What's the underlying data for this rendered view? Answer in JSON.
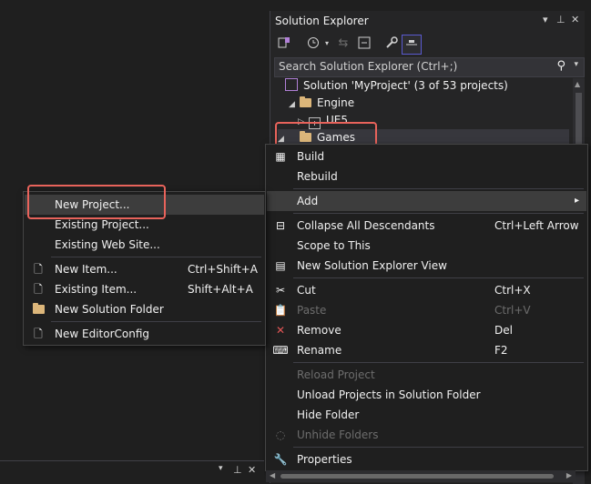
{
  "solution_explorer": {
    "title": "Solution Explorer",
    "title_icons": {
      "dropdown": "▾",
      "pin": "⊥",
      "close": "✕"
    },
    "search_placeholder": "Search Solution Explorer (Ctrl+;)",
    "tree": [
      {
        "label": "Solution 'MyProject' (3 of 53 projects)",
        "icon": "solution-icon"
      },
      {
        "label": "Engine",
        "icon": "folder-icon"
      },
      {
        "label": "UE5",
        "icon": "project-icon"
      },
      {
        "label": "Games",
        "icon": "folder-icon"
      }
    ]
  },
  "context_menu": {
    "items": [
      {
        "label": "Build",
        "icon": "build-icon"
      },
      {
        "label": "Rebuild"
      },
      {
        "label": "Add",
        "submenu_arrow": "▸"
      },
      {
        "label": "Collapse All Descendants",
        "shortcut": "Ctrl+Left Arrow",
        "icon": "collapse-icon"
      },
      {
        "label": "Scope to This"
      },
      {
        "label": "New Solution Explorer View",
        "icon": "new-view-icon"
      },
      {
        "label": "Cut",
        "shortcut": "Ctrl+X",
        "icon": "scissors-icon"
      },
      {
        "label": "Paste",
        "shortcut": "Ctrl+V",
        "icon": "paste-icon",
        "disabled": true
      },
      {
        "label": "Remove",
        "shortcut": "Del",
        "icon": "remove-icon"
      },
      {
        "label": "Rename",
        "shortcut": "F2",
        "icon": "rename-icon"
      },
      {
        "label": "Reload Project",
        "disabled": true
      },
      {
        "label": "Unload Projects in Solution Folder"
      },
      {
        "label": "Hide Folder"
      },
      {
        "label": "Unhide Folders",
        "disabled": true,
        "icon": "unhide-icon"
      },
      {
        "label": "Properties",
        "icon": "wrench-icon"
      }
    ]
  },
  "add_submenu": {
    "items": [
      {
        "label": "New Project..."
      },
      {
        "label": "Existing Project..."
      },
      {
        "label": "Existing Web Site..."
      },
      {
        "label": "New Item...",
        "shortcut": "Ctrl+Shift+A",
        "icon": "new-item-icon"
      },
      {
        "label": "Existing Item...",
        "shortcut": "Shift+Alt+A",
        "icon": "existing-item-icon"
      },
      {
        "label": "New Solution Folder",
        "icon": "new-folder-icon"
      },
      {
        "label": "New EditorConfig",
        "icon": "file-icon"
      }
    ]
  },
  "colors": {
    "highlight": "#e8635b",
    "accent": "#b180d7",
    "folder": "#dcb67a"
  }
}
